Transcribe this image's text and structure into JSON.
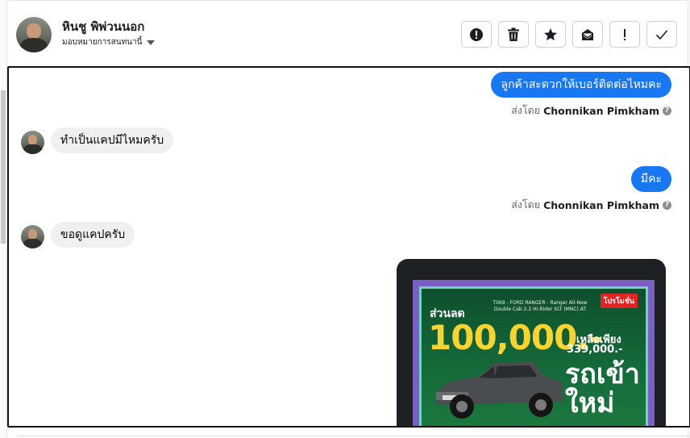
{
  "header": {
    "contact_name": "หินชู พิพ่วนนอก",
    "assign_label": "มอบหมายการสนทนานี้"
  },
  "actions": [
    {
      "name": "mark-spam",
      "icon": "alert-circle-icon"
    },
    {
      "name": "delete",
      "icon": "trash-icon"
    },
    {
      "name": "star",
      "icon": "star-icon"
    },
    {
      "name": "mark-unread",
      "icon": "envelope-icon"
    },
    {
      "name": "important",
      "icon": "exclamation-icon"
    },
    {
      "name": "done",
      "icon": "check-icon"
    }
  ],
  "messages": [
    {
      "direction": "out",
      "text": "ลูกค้าสะดวกให้เบอร์ติดต่อไหมคะ",
      "sent_by_label": "ส่งโดย",
      "agent": "Chonnikan Pimkham"
    },
    {
      "direction": "in",
      "text": "ทำเป็นแคปมีไหมครับ"
    },
    {
      "direction": "out",
      "text": "มีคะ",
      "sent_by_label": "ส่งโดย",
      "agent": "Chonnikan Pimkham"
    },
    {
      "direction": "in",
      "text": "ขอดูแคปครับ"
    }
  ],
  "promo_image": {
    "badge": "โปรโมชั่น",
    "model": "T069 - FORD RANGER - Ranger All-New Double Cab 2.2 Hi-Rider XLT (MNC) AT",
    "discount_label": "ส่วนลด",
    "discount": "100,000.-",
    "remain_label": "เหลือเพียง",
    "remain_price": "339,000.-",
    "new_car": "รถเข้าใหม่"
  },
  "colors": {
    "outgoing_bubble": "#1877f2",
    "incoming_bubble": "#f0f0f0"
  }
}
